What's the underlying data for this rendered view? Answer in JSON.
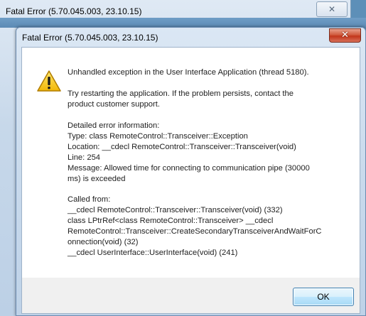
{
  "background_window": {
    "title": "Fatal Error (5.70.045.003, 23.10.15)",
    "close_label": "✕"
  },
  "dialog": {
    "title": "Fatal Error (5.70.045.003, 23.10.15)",
    "close_label": "✕",
    "icon": "warning-icon",
    "message": {
      "headline": "Unhandled exception in the User Interface Application (thread 5180).",
      "advice": "Try restarting the application. If the problem persists, contact the\nproduct customer support.",
      "details": "Detailed error information:\nType: class RemoteControl::Transceiver::Exception\nLocation: __cdecl RemoteControl::Transceiver::Transceiver(void)\nLine: 254\nMessage: Allowed time for connecting to communication pipe (30000\nms) is exceeded",
      "called_from": "Called from:\n__cdecl RemoteControl::Transceiver::Transceiver(void) (332)\nclass LPtrRef<class RemoteControl::Transceiver> __cdecl\nRemoteControl::Transceiver::CreateSecondaryTransceiverAndWaitForC\nonnection(void) (32)\n__cdecl UserInterface::UserInterface(void) (241)"
    },
    "ok_label": "OK"
  }
}
